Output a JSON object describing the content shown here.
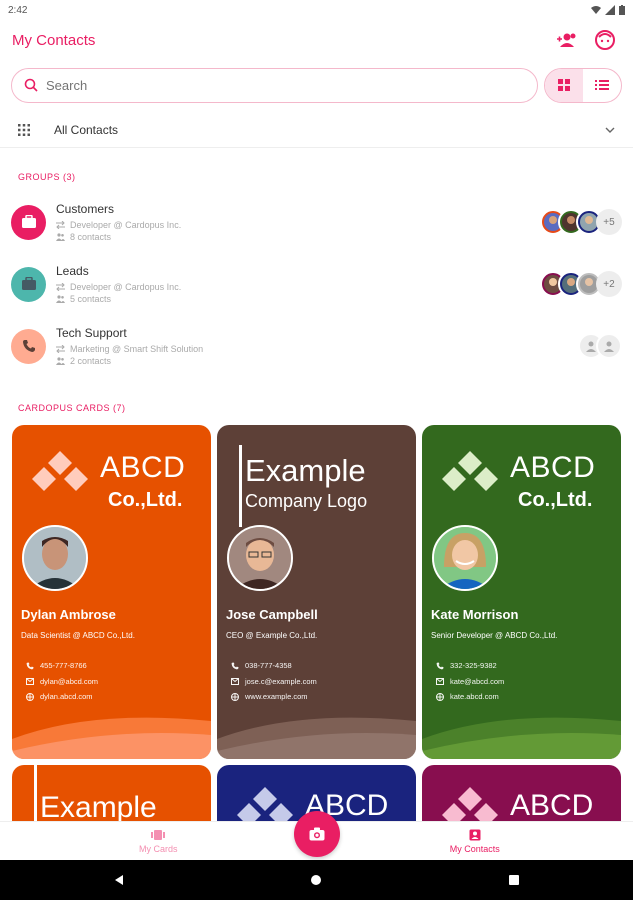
{
  "status": {
    "time": "2:42"
  },
  "app_bar": {
    "title": "My Contacts",
    "icons": [
      "add-contact-icon",
      "profile-face-icon"
    ]
  },
  "search": {
    "placeholder": "Search"
  },
  "filter": {
    "label": "All Contacts"
  },
  "groups_header": "GROUPS (3)",
  "groups": [
    {
      "name": "Customers",
      "detail": "Developer @ Cardopus Inc.",
      "count": "8 contacts",
      "color": "#e91e63",
      "icon": "briefcase-icon",
      "more": "+5"
    },
    {
      "name": "Leads",
      "detail": "Developer @ Cardopus Inc.",
      "count": "5 contacts",
      "color": "#4db6ac",
      "icon": "briefcase-icon",
      "more": "+2"
    },
    {
      "name": "Tech Support",
      "detail": "Marketing @ Smart Shift Solution",
      "count": "2 contacts",
      "color": "#ffab91",
      "icon": "phone-icon",
      "more": ""
    }
  ],
  "cards_header": "CARDOPUS CARDS (7)",
  "cards": [
    {
      "color": "#e65100",
      "wave": "#ff8a50",
      "brand": "ABCD",
      "brand_sub": "Co.,Ltd.",
      "name": "Dylan Ambrose",
      "role": "Data Scientist @ ABCD Co.,Ltd.",
      "phone": "455-777-8766",
      "email": "dylan@abcd.com",
      "web": "dylan.abcd.com"
    },
    {
      "color": "#5d4037",
      "wave": "#8d6e63",
      "brand": "Example",
      "brand_sub": "Company Logo",
      "name": "Jose Campbell",
      "role": "CEO @ Example Co.,Ltd.",
      "phone": "038-777-4358",
      "email": "jose.c@example.com",
      "web": "www.example.com"
    },
    {
      "color": "#33691e",
      "wave": "#558b2f",
      "brand": "ABCD",
      "brand_sub": "Co.,Ltd.",
      "name": "Kate Morrison",
      "role": "Senior Developer @ ABCD Co.,Ltd.",
      "phone": "332-325-9382",
      "email": "kate@abcd.com",
      "web": "kate.abcd.com"
    }
  ],
  "bottom_cards": [
    {
      "color": "#e65100",
      "brand": "Example"
    },
    {
      "color": "#1a237e",
      "brand": "ABCD"
    },
    {
      "color": "#880e4f",
      "brand": "ABCD"
    }
  ],
  "nav": {
    "left": "My Cards",
    "right": "My Contacts"
  }
}
